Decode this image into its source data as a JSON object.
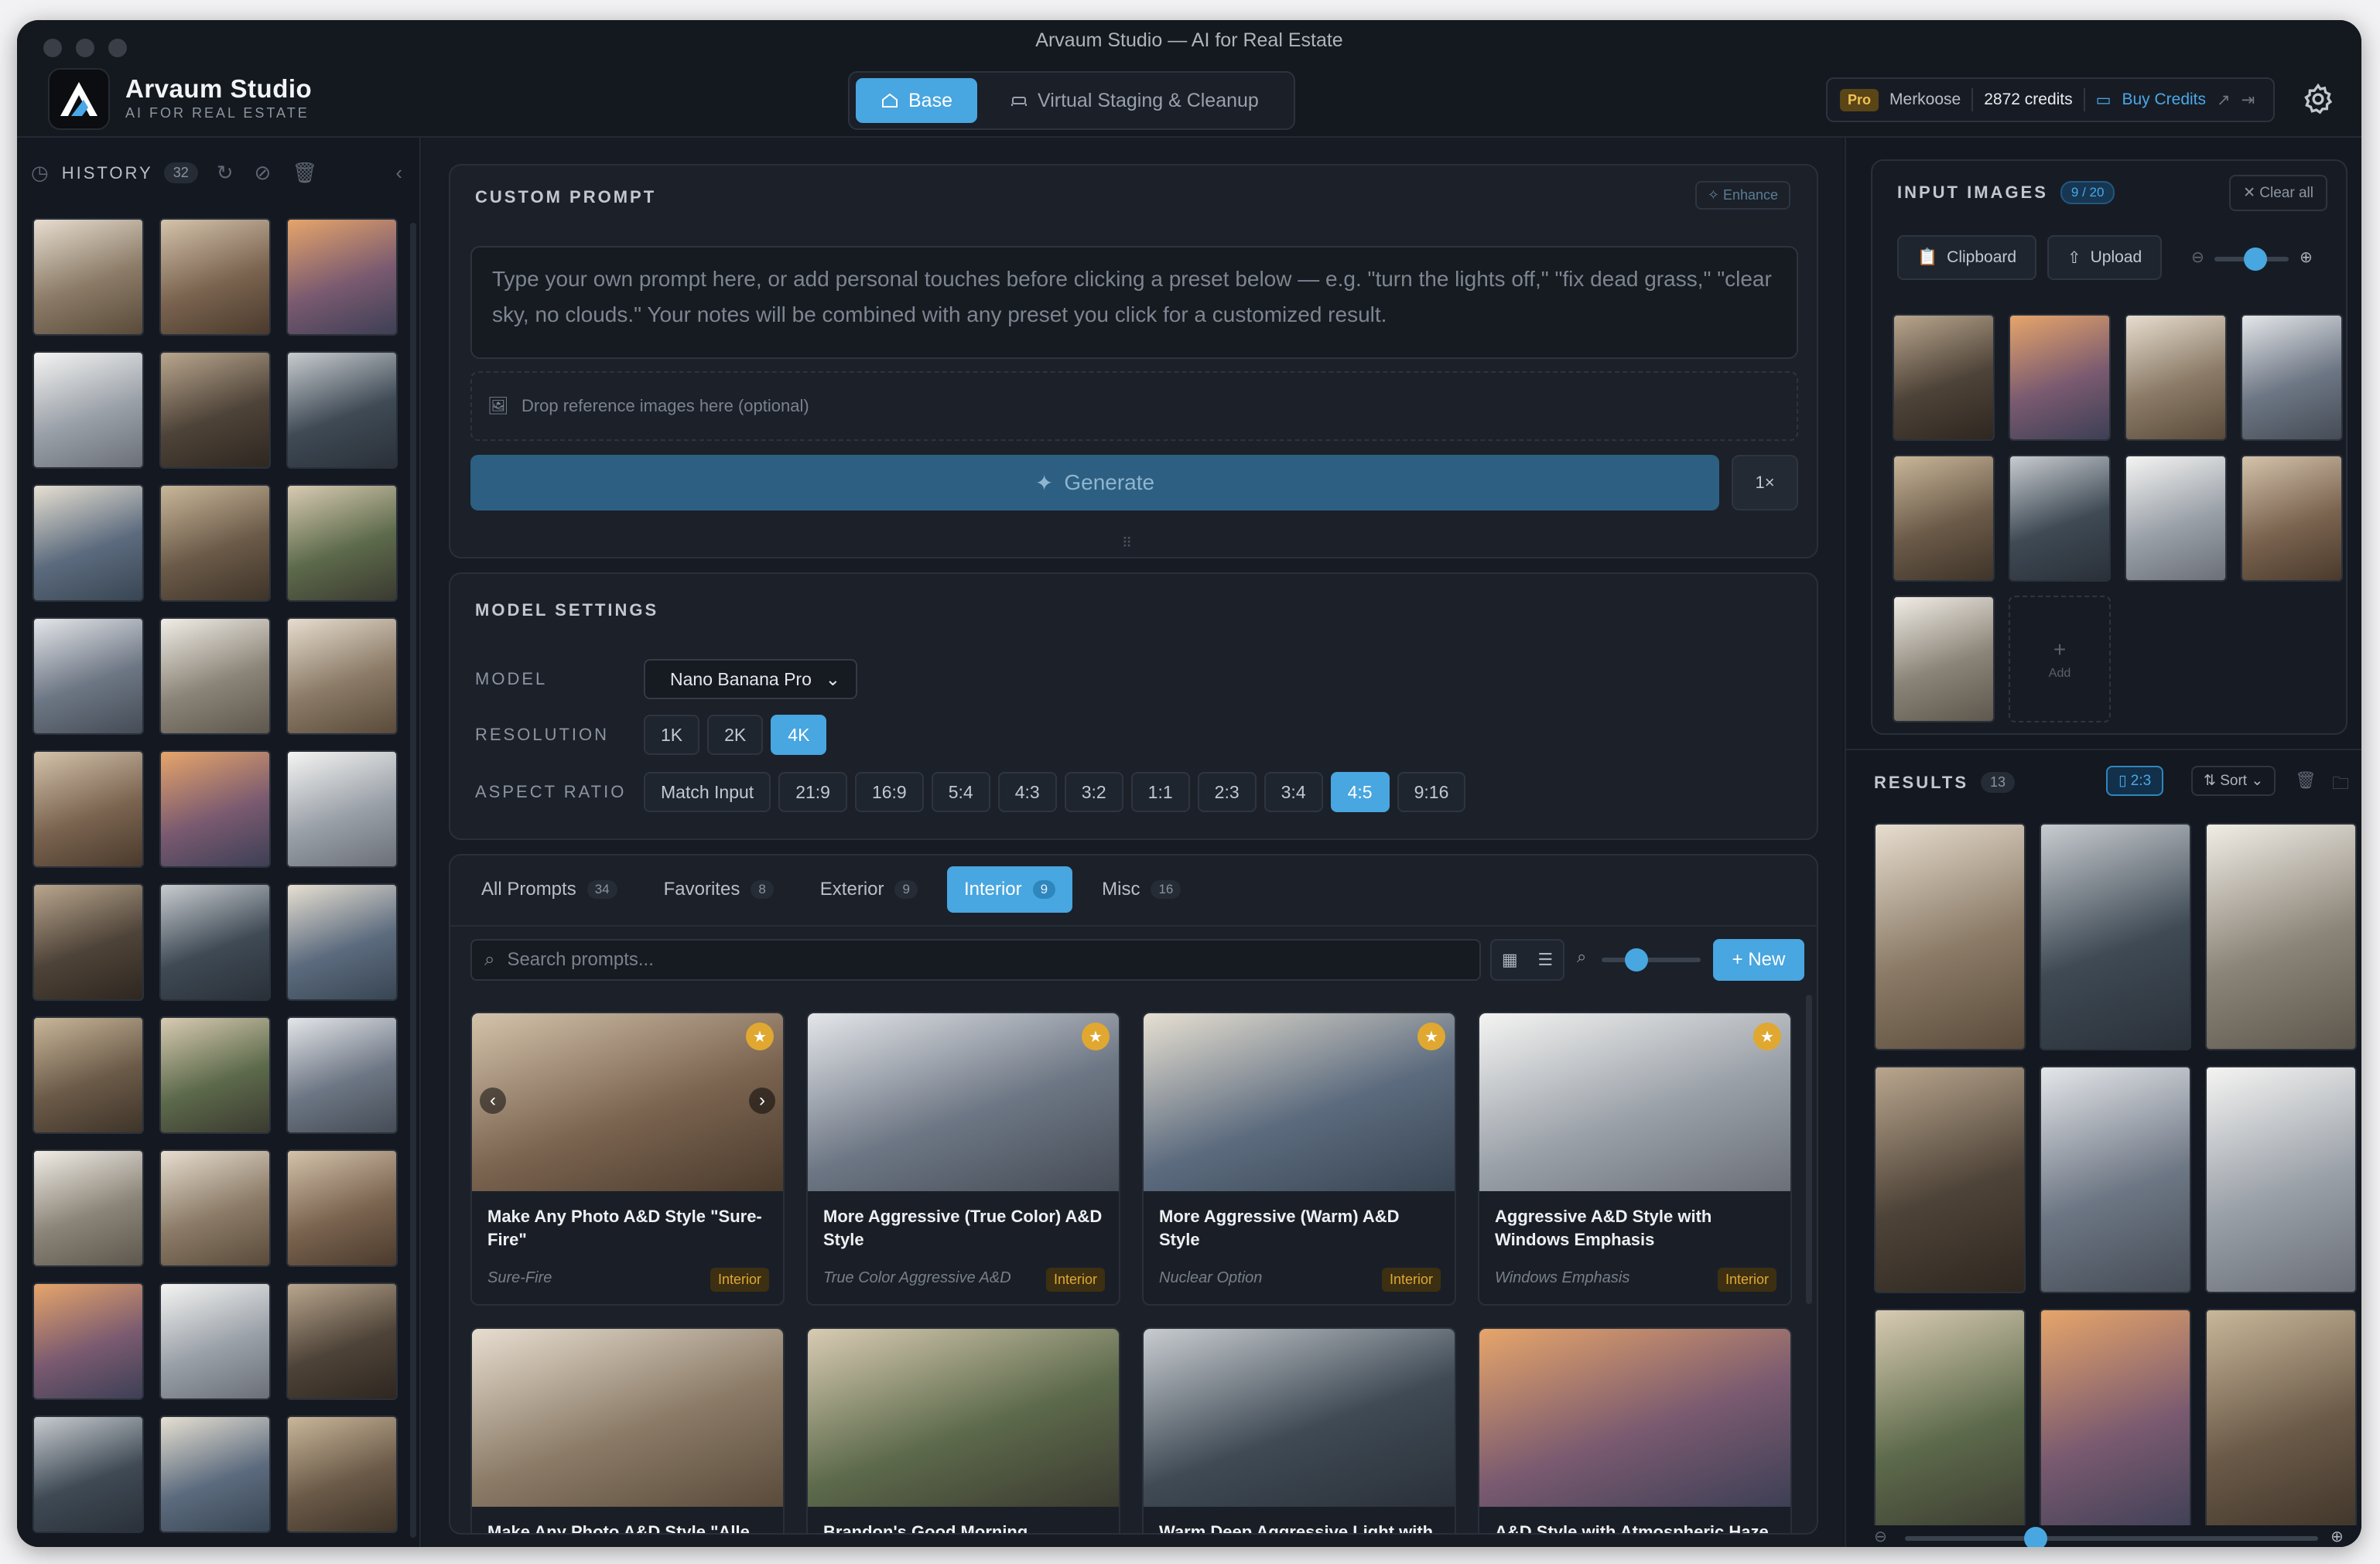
{
  "window": {
    "title": "Arvaum Studio — AI for Real Estate"
  },
  "brand": {
    "name": "Arvaum Studio",
    "tagline": "AI FOR REAL ESTATE"
  },
  "modes": [
    {
      "label": "Base",
      "active": true
    },
    {
      "label": "Virtual Staging & Cleanup",
      "active": false
    }
  ],
  "account": {
    "plan": "Pro",
    "user": "Merkoose",
    "credits": "2872 credits",
    "buy": "Buy Credits"
  },
  "history": {
    "label": "HISTORY",
    "count": "32",
    "thumb_count": 30
  },
  "custom_prompt": {
    "title": "CUSTOM PROMPT",
    "enhance": "Enhance",
    "placeholder": "Type your own prompt here, or add personal touches before clicking a preset below — e.g. \"turn the lights off,\" \"fix dead grass,\" \"clear sky, no clouds.\" Your notes will be combined with any preset you click for a customized result.",
    "drop": "Drop reference images here (optional)",
    "generate": "Generate",
    "multiplier": "1×"
  },
  "model_settings": {
    "title": "MODEL SETTINGS",
    "model_label": "MODEL",
    "model_value": "Nano Banana Pro",
    "resolution_label": "RESOLUTION",
    "resolutions": [
      "1K",
      "2K",
      "4K"
    ],
    "resolution_selected": "4K",
    "aspect_label": "ASPECT RATIO",
    "aspects": [
      "Match Input",
      "21:9",
      "16:9",
      "5:4",
      "4:3",
      "3:2",
      "1:1",
      "2:3",
      "3:4",
      "4:5",
      "9:16"
    ],
    "aspect_selected": "4:5"
  },
  "prompt_tabs": [
    {
      "label": "All Prompts",
      "count": "34",
      "active": false
    },
    {
      "label": "Favorites",
      "count": "8",
      "active": false
    },
    {
      "label": "Exterior",
      "count": "9",
      "active": false
    },
    {
      "label": "Interior",
      "count": "9",
      "active": true
    },
    {
      "label": "Misc",
      "count": "16",
      "active": false
    }
  ],
  "prompt_search": {
    "placeholder": "Search prompts...",
    "new": "New"
  },
  "prompt_cards": [
    {
      "title": "Make Any Photo A&D Style \"Sure-Fire\"",
      "subtitle": "Sure-Fire",
      "category": "Interior"
    },
    {
      "title": "More Aggressive (True Color) A&D Style",
      "subtitle": "True Color Aggressive A&D",
      "category": "Interior"
    },
    {
      "title": "More Aggressive (Warm) A&D Style",
      "subtitle": "Nuclear Option",
      "category": "Interior"
    },
    {
      "title": "Aggressive A&D Style with Windows Emphasis",
      "subtitle": "Windows Emphasis",
      "category": "Interior"
    },
    {
      "title": "Make Any Photo A&D Style \"Alle",
      "subtitle": "",
      "category": ""
    },
    {
      "title": "Brandon's Good Morning",
      "subtitle": "",
      "category": ""
    },
    {
      "title": "Warm Deep Aggressive Light with",
      "subtitle": "",
      "category": ""
    },
    {
      "title": "A&D Style with Atmospheric Haze",
      "subtitle": "",
      "category": ""
    }
  ],
  "input_images": {
    "title": "INPUT IMAGES",
    "count": "9 / 20",
    "clear": "Clear all",
    "clipboard": "Clipboard",
    "upload": "Upload",
    "add": "Add",
    "image_count": 9
  },
  "results": {
    "title": "RESULTS",
    "count": "13",
    "ratio": "2:3",
    "sort": "Sort",
    "image_count": 9
  },
  "colors": {
    "accent": "#48a6e0",
    "gold": "#e0a830",
    "bg": "#141820"
  }
}
